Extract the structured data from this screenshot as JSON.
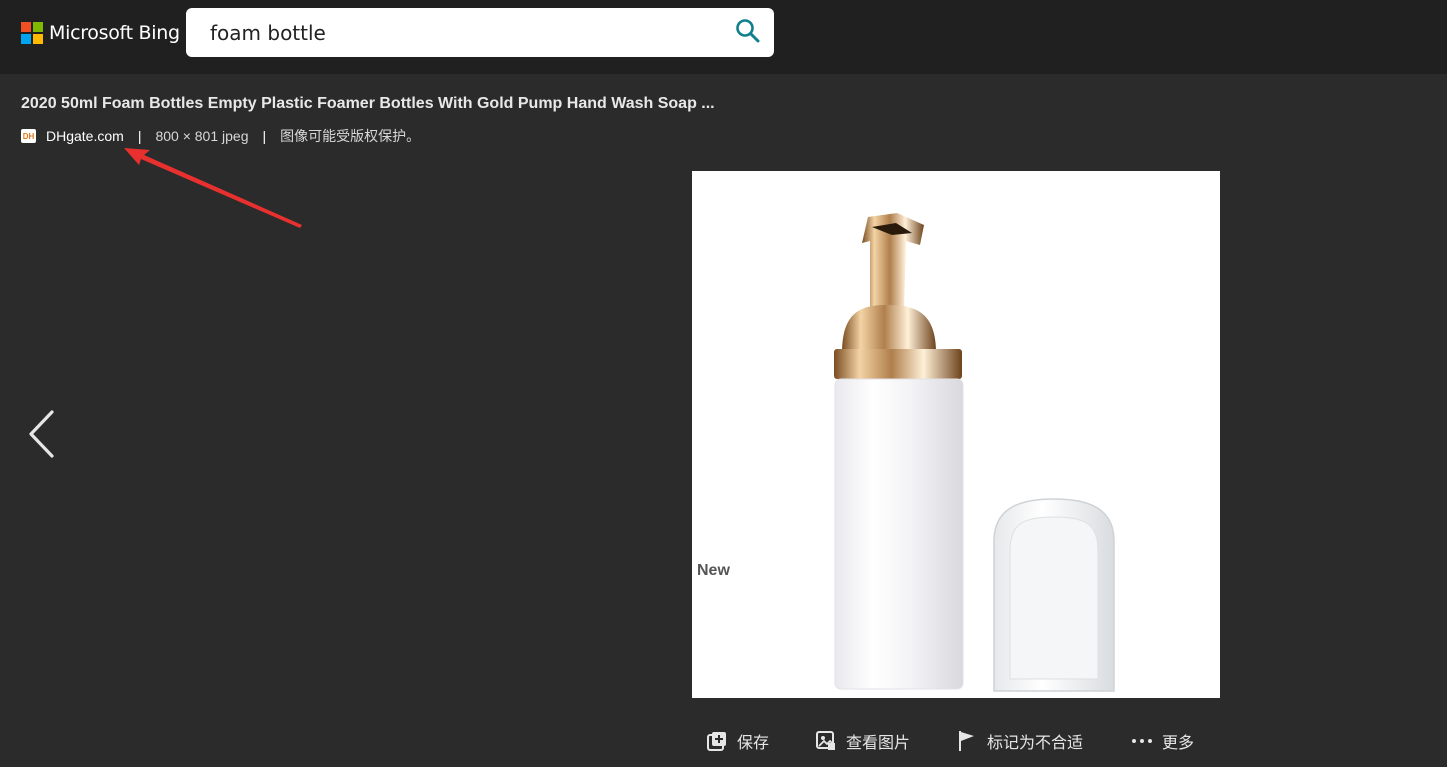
{
  "header": {
    "brand_name": "Microsoft Bing",
    "brand_colors": [
      "#f25022",
      "#7fba00",
      "#00a4ef",
      "#ffb900"
    ],
    "search": {
      "value": "foam bottle",
      "icon": "search-icon"
    }
  },
  "detail": {
    "title": "2020 50ml Foam Bottles Empty Plastic Foamer Bottles With Gold Pump Hand Wash Soap ...",
    "source": {
      "favicon_text": "DH",
      "name": "DHgate.com"
    },
    "separator": "|",
    "image_info": "800 × 801 jpeg",
    "copyright_note": "图像可能受版权保护。",
    "image_overlay_text": "New"
  },
  "navigation": {
    "prev_icon": "chevron-left-icon"
  },
  "actions": [
    {
      "label": "保存",
      "icon": "save-add-icon"
    },
    {
      "label": "查看图片",
      "icon": "view-image-icon"
    },
    {
      "label": "标记为不合适",
      "icon": "flag-icon"
    },
    {
      "label": "更多",
      "icon": "more-dots-icon"
    }
  ],
  "colors": {
    "background": "#2b2b2b",
    "topbar": "#202020",
    "search_icon": "#0f7f8c",
    "annotation_arrow": "#e8312f"
  }
}
